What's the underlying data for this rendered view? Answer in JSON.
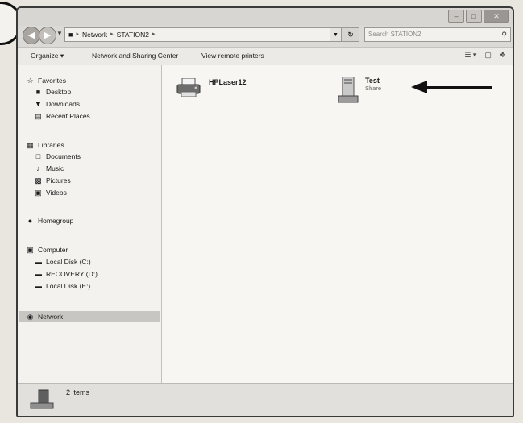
{
  "address": {
    "crumbs": [
      "Network",
      "STATION2"
    ],
    "search_placeholder": "Search STATION2"
  },
  "toolbar": {
    "organize": "Organize ▾",
    "network_sharing": "Network and Sharing Center",
    "view_printers": "View remote printers"
  },
  "nav": {
    "favorites": {
      "label": "Favorites",
      "items": [
        "Desktop",
        "Downloads",
        "Recent Places"
      ]
    },
    "libraries": {
      "label": "Libraries",
      "items": [
        "Documents",
        "Music",
        "Pictures",
        "Videos"
      ]
    },
    "homegroup": "Homegroup",
    "computer": {
      "label": "Computer",
      "items": [
        "Local Disk (C:)",
        "RECOVERY (D:)",
        "Local Disk (E:)"
      ]
    },
    "network": "Network"
  },
  "files": [
    {
      "name": "HPLaser12",
      "sub": "",
      "icon": "printer-icon"
    },
    {
      "name": "Test",
      "sub": "Share",
      "icon": "shared-folder-icon"
    }
  ],
  "status": {
    "count": "2 items"
  },
  "colors": {
    "annotation_arrow": "#111111",
    "selected_nav": "#c8c6c3"
  }
}
